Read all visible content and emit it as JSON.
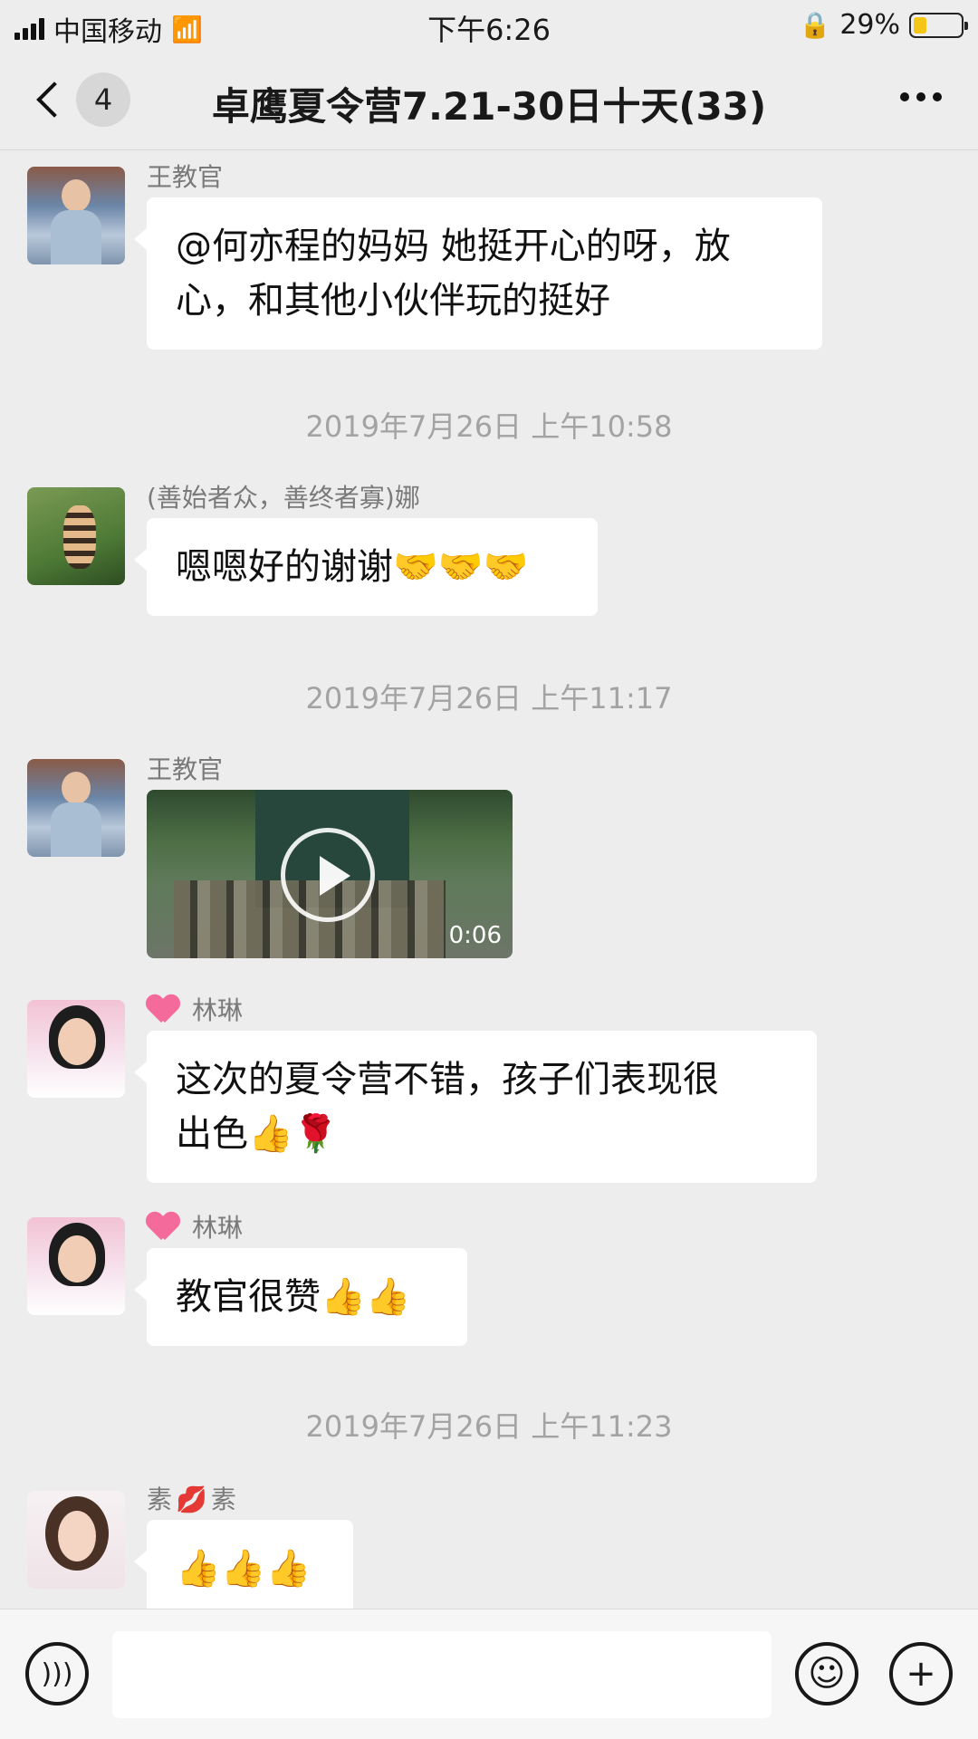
{
  "status_bar": {
    "carrier": "中国移动",
    "time": "下午6:26",
    "battery_percent": "29%",
    "battery_level": 0.29
  },
  "nav": {
    "unread_count": "4",
    "title": "卓鹰夏令营7.21-30日十天(33)"
  },
  "messages": [
    {
      "sender": "王教官",
      "text_lines": [
        "@何亦程的妈妈 她挺开心的呀，放",
        "心，和其他小伙伴玩的挺好"
      ]
    },
    {
      "timestamp": "2019年7月26日 上午10:58"
    },
    {
      "sender": "(善始者众，善终者寡)娜",
      "text": "嗯嗯好的谢谢🤝🤝🤝"
    },
    {
      "timestamp": "2019年7月26日 上午11:17"
    },
    {
      "sender": "王教官",
      "video_duration": "0:06"
    },
    {
      "sender": "林琳",
      "text_lines": [
        "这次的夏令营不错，孩子们表现很",
        "出色👍🌹"
      ]
    },
    {
      "sender": "林琳",
      "text": "教官很赞👍👍"
    },
    {
      "timestamp": "2019年7月26日 上午11:23"
    },
    {
      "sender_prefix": "素",
      "sender_suffix": "素",
      "sender_emoji": "💋",
      "text": "👍👍👍"
    }
  ],
  "input_bar": {
    "voice_icon": "voice-icon",
    "emoji_icon": "emoji-icon",
    "plus_icon": "plus-icon"
  }
}
